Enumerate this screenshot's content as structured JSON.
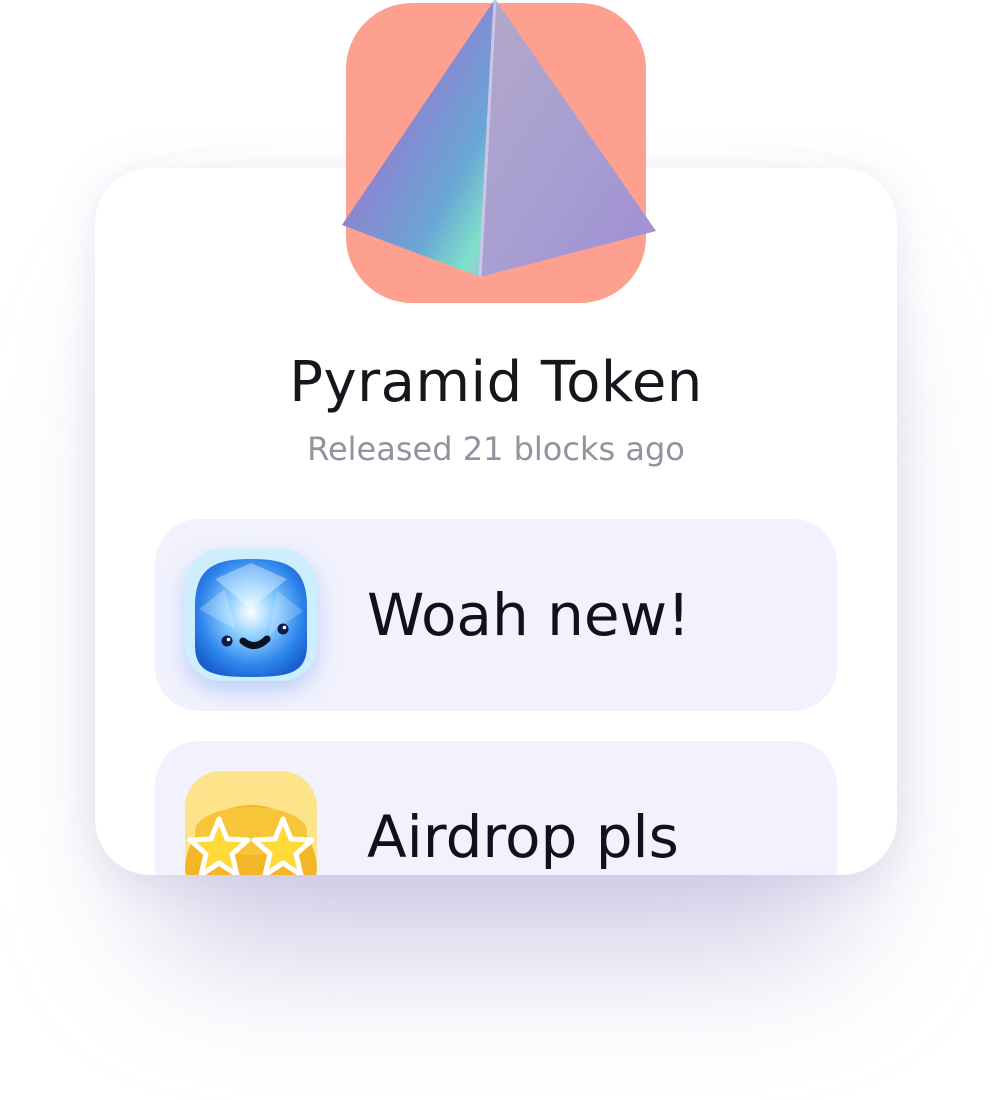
{
  "token": {
    "name": "Pyramid Token",
    "released": "Released 21 blocks ago",
    "icon": "pyramid-icon",
    "icon_background": "#fea08f"
  },
  "comments": [
    {
      "text": "Woah new!",
      "avatar": "gem-face-avatar"
    },
    {
      "text": "Airdrop pls",
      "avatar": "star-eyes-avatar"
    }
  ],
  "colors": {
    "title": "#16161c",
    "subtitle": "#92939e",
    "comment_background": "#f2f2fe",
    "card_background": "#ffffff"
  }
}
